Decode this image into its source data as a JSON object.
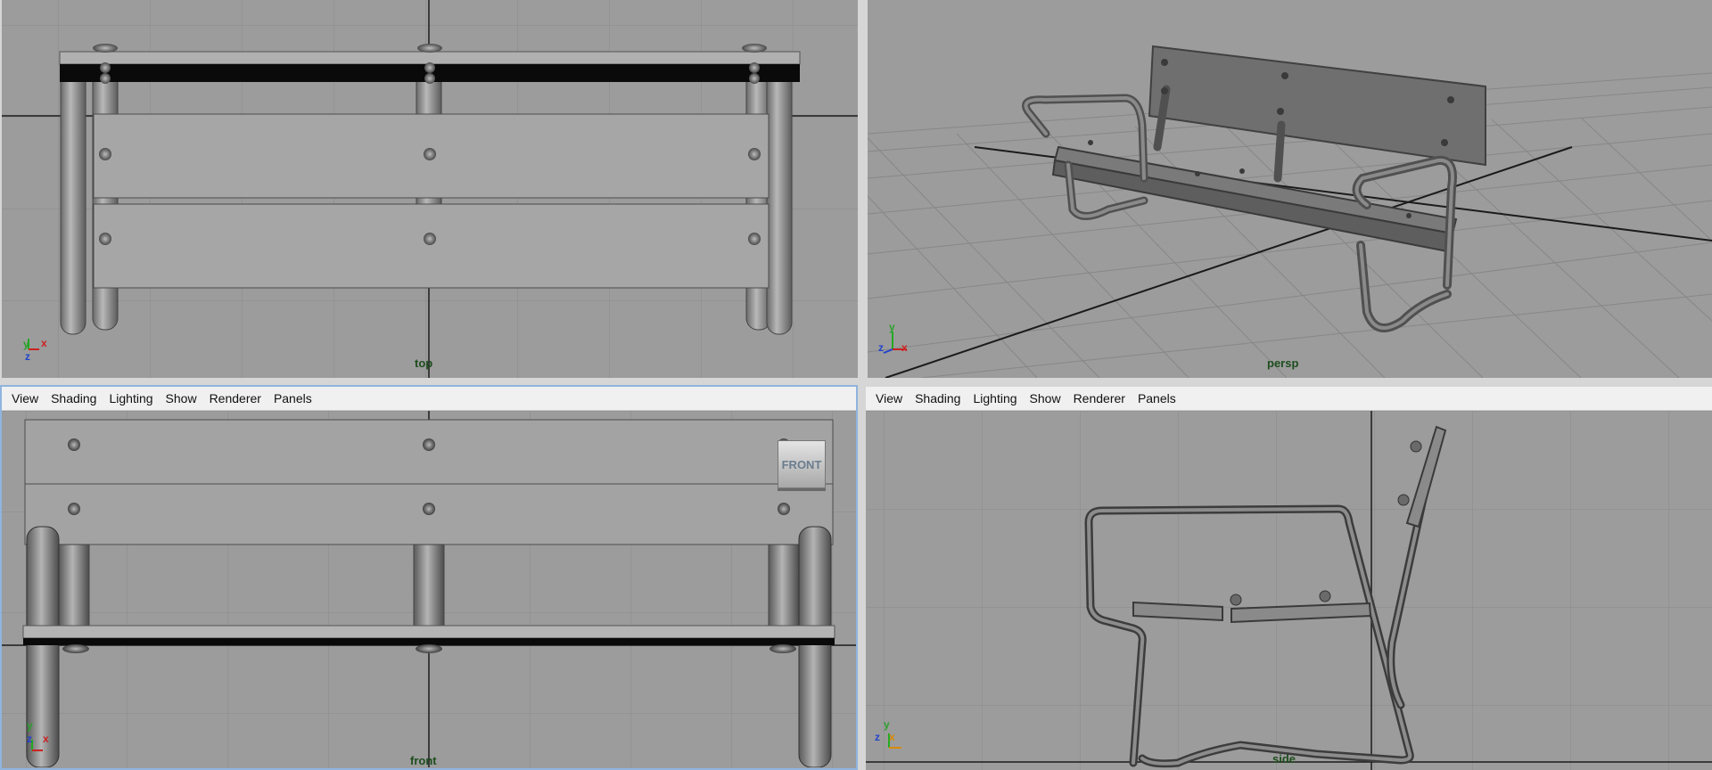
{
  "menu": {
    "items": [
      "View",
      "Shading",
      "Lighting",
      "Show",
      "Renderer",
      "Panels"
    ]
  },
  "viewports": {
    "top": {
      "label": "top"
    },
    "persp": {
      "label": "persp"
    },
    "front": {
      "label": "front"
    },
    "side": {
      "label": "side"
    }
  },
  "viewcube": {
    "label": "FRONT"
  },
  "axes": {
    "x": "x",
    "y": "y",
    "z": "z"
  },
  "colors": {
    "viewport_bg": "#9c9c9c",
    "grid": "#8a8a8a",
    "axis_line": "#1b1b1b",
    "label": "#1e4d1e",
    "menubar": "#f0f0f0",
    "active_border": "#8fb4de"
  }
}
